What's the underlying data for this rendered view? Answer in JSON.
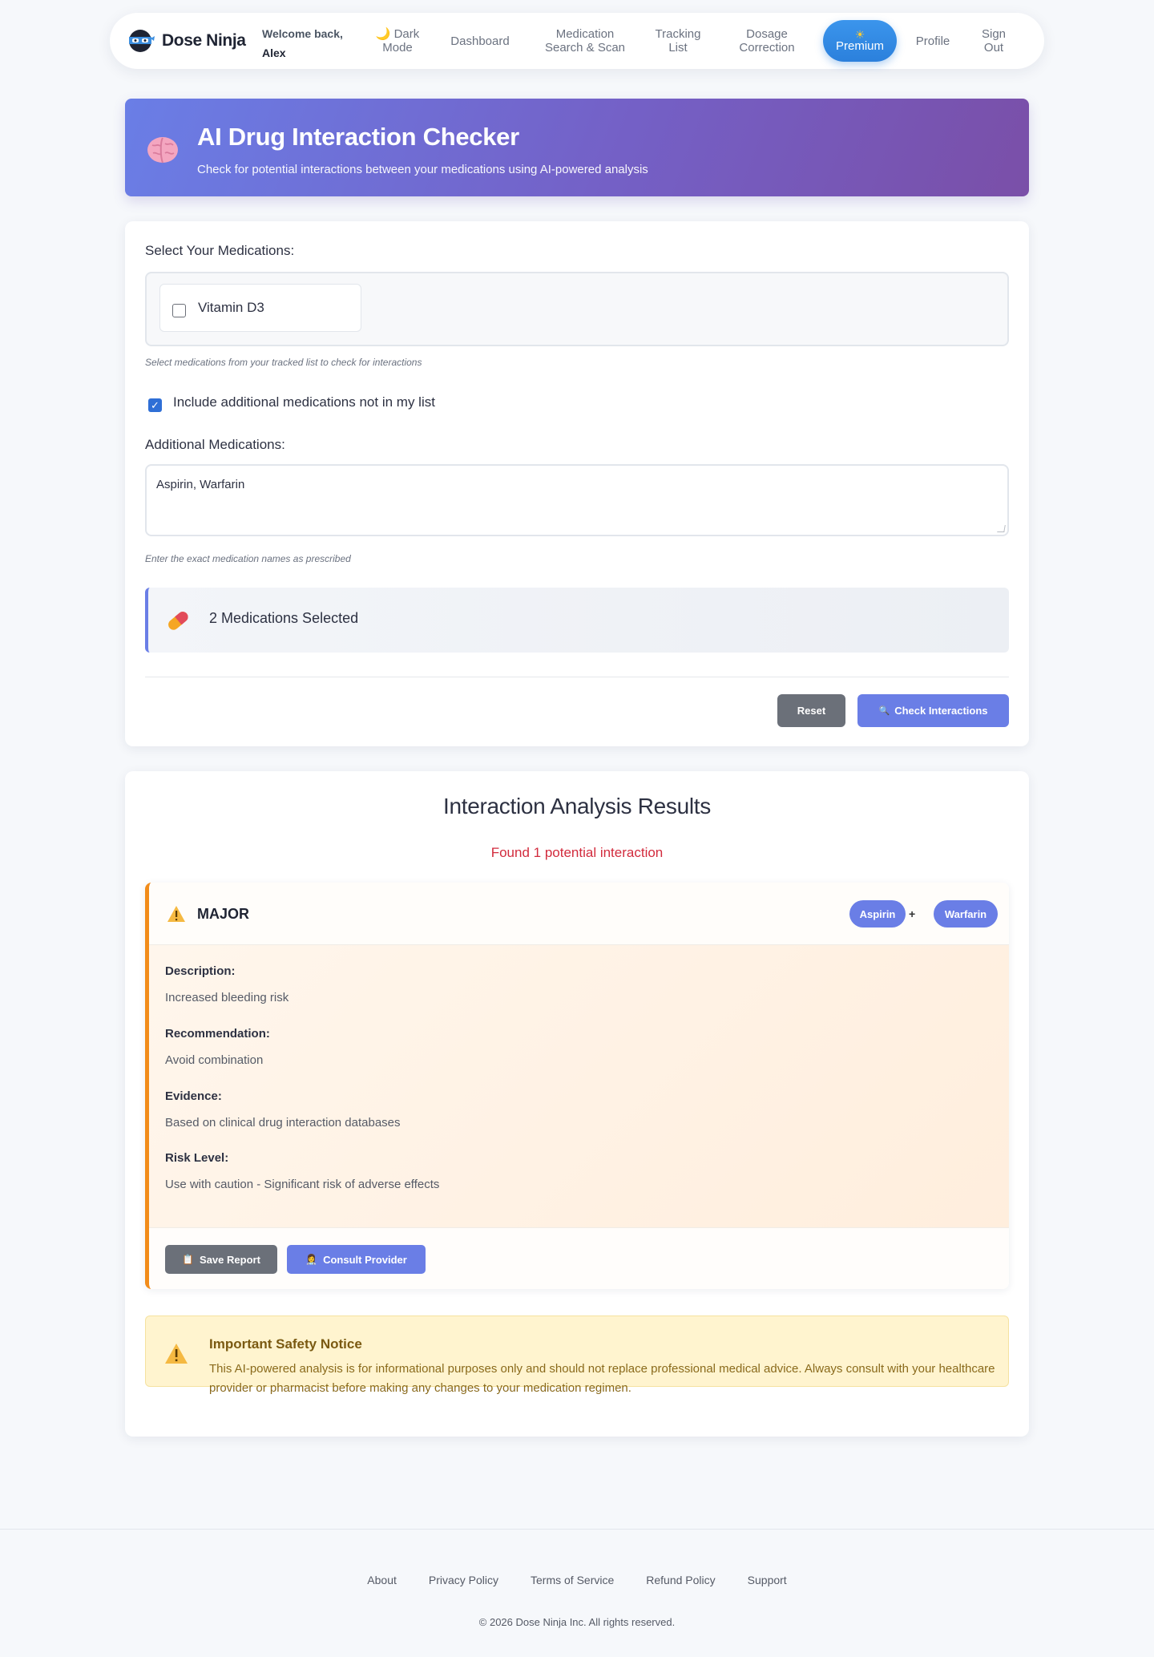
{
  "nav": {
    "brand": "Dose Ninja",
    "welcome_line1": "Welcome back,",
    "welcome_user": "Alex",
    "dark_mode": "🌙 Dark Mode",
    "dashboard": "Dashboard",
    "medication_search": "Medication Search & Scan",
    "tracking_list": "Tracking List",
    "dosage_correction": "Dosage Correction",
    "premium_icon": "☀",
    "premium": "Premium",
    "profile": "Profile",
    "sign_out": "Sign Out"
  },
  "header": {
    "icon": "brain-icon",
    "title": "AI Drug Interaction Checker",
    "subtitle": "Check for potential interactions between your medications using AI-powered analysis"
  },
  "form": {
    "select_label": "Select Your Medications:",
    "medications": [
      {
        "name": "Vitamin D3",
        "checked": false
      }
    ],
    "select_hint": "Select medications from your tracked list to check for interactions",
    "include_label": "Include additional medications not in my list",
    "include_checked": true,
    "additional_label": "Additional Medications:",
    "additional_value": "Aspirin, Warfarin",
    "additional_hint": "Enter the exact medication names as prescribed",
    "selected_summary": "2 Medications Selected",
    "reset_label": "Reset",
    "check_label": "Check Interactions"
  },
  "results": {
    "title": "Interaction Analysis Results",
    "found": "Found 1 potential interaction",
    "interaction": {
      "severity": "MAJOR",
      "drug_a": "Aspirin",
      "plus": "+",
      "drug_b": "Warfarin",
      "description_label": "Description:",
      "description": "Increased bleeding risk",
      "recommendation_label": "Recommendation:",
      "recommendation": "Avoid combination",
      "evidence_label": "Evidence:",
      "evidence": "Based on clinical drug interaction databases",
      "risk_label": "Risk Level:",
      "risk": "Use with caution - Significant risk of adverse effects",
      "save_label": "Save Report",
      "consult_label": "Consult Provider"
    },
    "notice": {
      "title": "Important Safety Notice",
      "text": "This AI-powered analysis is for informational purposes only and should not replace professional medical advice. Always consult with your healthcare provider or pharmacist before making any changes to your medication regimen."
    }
  },
  "footer": {
    "links": [
      "About",
      "Privacy Policy",
      "Terms of Service",
      "Refund Policy",
      "Support"
    ],
    "copyright": "© 2026 Dose Ninja Inc. All rights reserved."
  },
  "colors": {
    "accent": "#6a7ee6",
    "premium": "#2b80dc",
    "danger": "#d22b3d",
    "major_border": "#f28c1a",
    "notice_bg": "#fff4cf"
  }
}
